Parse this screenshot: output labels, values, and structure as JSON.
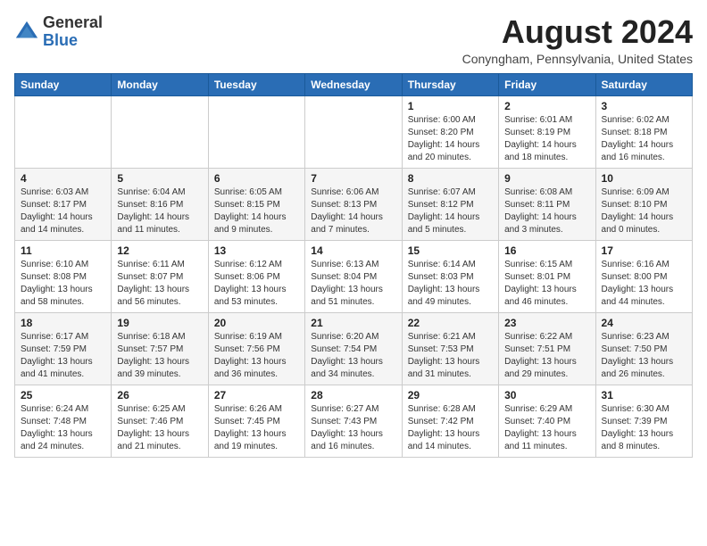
{
  "logo": {
    "general": "General",
    "blue": "Blue"
  },
  "header": {
    "month_year": "August 2024",
    "location": "Conyngham, Pennsylvania, United States"
  },
  "days_of_week": [
    "Sunday",
    "Monday",
    "Tuesday",
    "Wednesday",
    "Thursday",
    "Friday",
    "Saturday"
  ],
  "weeks": [
    [
      {
        "day": "",
        "info": ""
      },
      {
        "day": "",
        "info": ""
      },
      {
        "day": "",
        "info": ""
      },
      {
        "day": "",
        "info": ""
      },
      {
        "day": "1",
        "info": "Sunrise: 6:00 AM\nSunset: 8:20 PM\nDaylight: 14 hours\nand 20 minutes."
      },
      {
        "day": "2",
        "info": "Sunrise: 6:01 AM\nSunset: 8:19 PM\nDaylight: 14 hours\nand 18 minutes."
      },
      {
        "day": "3",
        "info": "Sunrise: 6:02 AM\nSunset: 8:18 PM\nDaylight: 14 hours\nand 16 minutes."
      }
    ],
    [
      {
        "day": "4",
        "info": "Sunrise: 6:03 AM\nSunset: 8:17 PM\nDaylight: 14 hours\nand 14 minutes."
      },
      {
        "day": "5",
        "info": "Sunrise: 6:04 AM\nSunset: 8:16 PM\nDaylight: 14 hours\nand 11 minutes."
      },
      {
        "day": "6",
        "info": "Sunrise: 6:05 AM\nSunset: 8:15 PM\nDaylight: 14 hours\nand 9 minutes."
      },
      {
        "day": "7",
        "info": "Sunrise: 6:06 AM\nSunset: 8:13 PM\nDaylight: 14 hours\nand 7 minutes."
      },
      {
        "day": "8",
        "info": "Sunrise: 6:07 AM\nSunset: 8:12 PM\nDaylight: 14 hours\nand 5 minutes."
      },
      {
        "day": "9",
        "info": "Sunrise: 6:08 AM\nSunset: 8:11 PM\nDaylight: 14 hours\nand 3 minutes."
      },
      {
        "day": "10",
        "info": "Sunrise: 6:09 AM\nSunset: 8:10 PM\nDaylight: 14 hours\nand 0 minutes."
      }
    ],
    [
      {
        "day": "11",
        "info": "Sunrise: 6:10 AM\nSunset: 8:08 PM\nDaylight: 13 hours\nand 58 minutes."
      },
      {
        "day": "12",
        "info": "Sunrise: 6:11 AM\nSunset: 8:07 PM\nDaylight: 13 hours\nand 56 minutes."
      },
      {
        "day": "13",
        "info": "Sunrise: 6:12 AM\nSunset: 8:06 PM\nDaylight: 13 hours\nand 53 minutes."
      },
      {
        "day": "14",
        "info": "Sunrise: 6:13 AM\nSunset: 8:04 PM\nDaylight: 13 hours\nand 51 minutes."
      },
      {
        "day": "15",
        "info": "Sunrise: 6:14 AM\nSunset: 8:03 PM\nDaylight: 13 hours\nand 49 minutes."
      },
      {
        "day": "16",
        "info": "Sunrise: 6:15 AM\nSunset: 8:01 PM\nDaylight: 13 hours\nand 46 minutes."
      },
      {
        "day": "17",
        "info": "Sunrise: 6:16 AM\nSunset: 8:00 PM\nDaylight: 13 hours\nand 44 minutes."
      }
    ],
    [
      {
        "day": "18",
        "info": "Sunrise: 6:17 AM\nSunset: 7:59 PM\nDaylight: 13 hours\nand 41 minutes."
      },
      {
        "day": "19",
        "info": "Sunrise: 6:18 AM\nSunset: 7:57 PM\nDaylight: 13 hours\nand 39 minutes."
      },
      {
        "day": "20",
        "info": "Sunrise: 6:19 AM\nSunset: 7:56 PM\nDaylight: 13 hours\nand 36 minutes."
      },
      {
        "day": "21",
        "info": "Sunrise: 6:20 AM\nSunset: 7:54 PM\nDaylight: 13 hours\nand 34 minutes."
      },
      {
        "day": "22",
        "info": "Sunrise: 6:21 AM\nSunset: 7:53 PM\nDaylight: 13 hours\nand 31 minutes."
      },
      {
        "day": "23",
        "info": "Sunrise: 6:22 AM\nSunset: 7:51 PM\nDaylight: 13 hours\nand 29 minutes."
      },
      {
        "day": "24",
        "info": "Sunrise: 6:23 AM\nSunset: 7:50 PM\nDaylight: 13 hours\nand 26 minutes."
      }
    ],
    [
      {
        "day": "25",
        "info": "Sunrise: 6:24 AM\nSunset: 7:48 PM\nDaylight: 13 hours\nand 24 minutes."
      },
      {
        "day": "26",
        "info": "Sunrise: 6:25 AM\nSunset: 7:46 PM\nDaylight: 13 hours\nand 21 minutes."
      },
      {
        "day": "27",
        "info": "Sunrise: 6:26 AM\nSunset: 7:45 PM\nDaylight: 13 hours\nand 19 minutes."
      },
      {
        "day": "28",
        "info": "Sunrise: 6:27 AM\nSunset: 7:43 PM\nDaylight: 13 hours\nand 16 minutes."
      },
      {
        "day": "29",
        "info": "Sunrise: 6:28 AM\nSunset: 7:42 PM\nDaylight: 13 hours\nand 14 minutes."
      },
      {
        "day": "30",
        "info": "Sunrise: 6:29 AM\nSunset: 7:40 PM\nDaylight: 13 hours\nand 11 minutes."
      },
      {
        "day": "31",
        "info": "Sunrise: 6:30 AM\nSunset: 7:39 PM\nDaylight: 13 hours\nand 8 minutes."
      }
    ]
  ]
}
